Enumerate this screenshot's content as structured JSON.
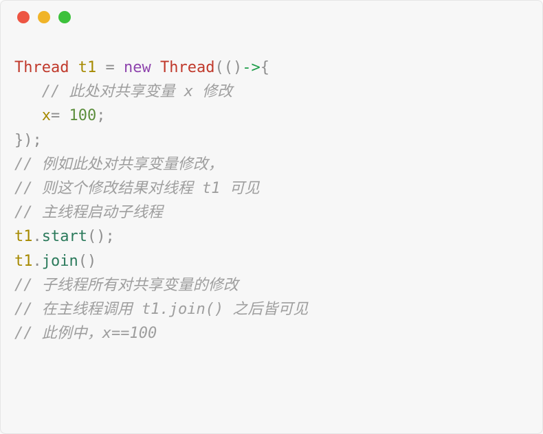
{
  "code": {
    "line1": {
      "type1": "Thread",
      "var": "t1",
      "punct_eq": " = ",
      "keyword": "new",
      "type2": " Thread",
      "open": "(()",
      "arrow": "->",
      "brace": "{"
    },
    "line2_comment": "   // 此处对共享变量 x 修改",
    "line3": {
      "indent": "   ",
      "var": "x",
      "eq": "= ",
      "num": "100",
      "semi": ";"
    },
    "line4_close": "});",
    "line5_comment": "// 例如此处对共享变量修改，",
    "line6_comment": "// 则这个修改结果对线程 t1 可见",
    "line7_comment": "// 主线程启动子线程",
    "line8": {
      "var": "t1",
      "dot": ".",
      "method": "start",
      "paren": "();"
    },
    "line9": {
      "var": "t1",
      "dot": ".",
      "method": "join",
      "paren": "()"
    },
    "line10_comment": "// 子线程所有对共享变量的修改",
    "line11_comment": "// 在主线程调用 t1.join() 之后皆可见",
    "line12_comment": "// 此例中，x==100"
  }
}
